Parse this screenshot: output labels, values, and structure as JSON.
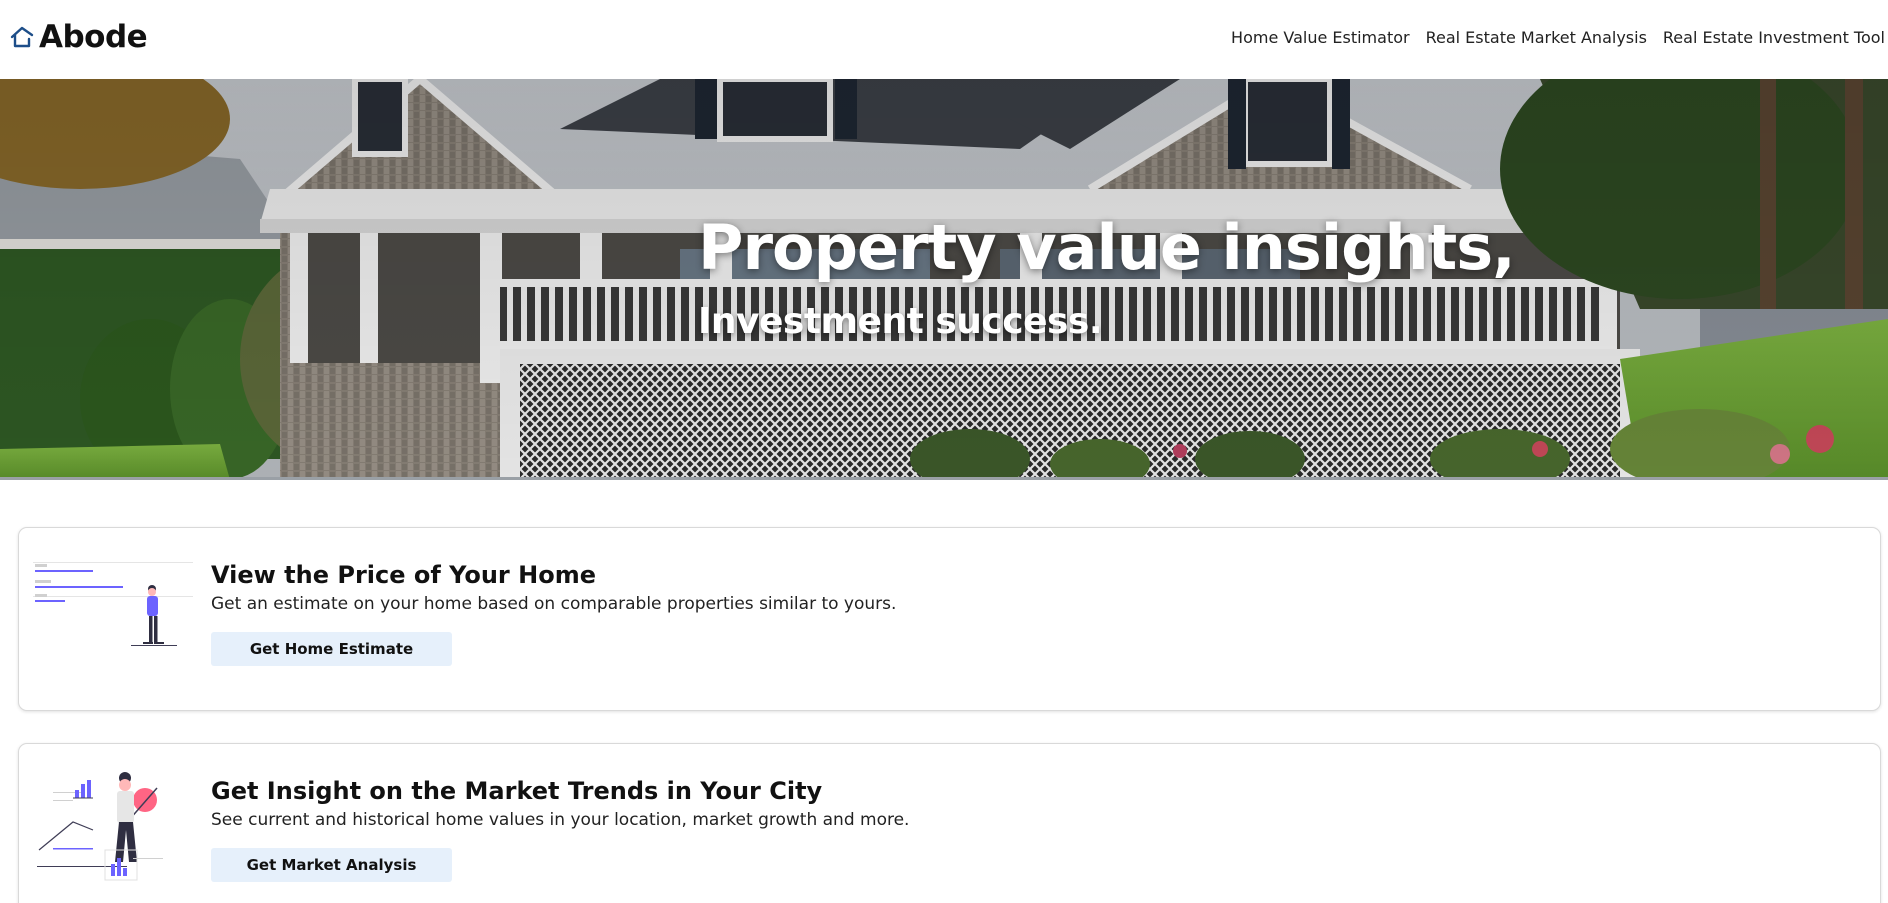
{
  "brand": {
    "name": "Abode",
    "icon": "house-icon",
    "accent": "#1d4e89"
  },
  "nav": {
    "items": [
      {
        "label": "Home Value Estimator"
      },
      {
        "label": "Real Estate Market Analysis"
      },
      {
        "label": "Real Estate Investment Tool"
      }
    ]
  },
  "hero": {
    "title": "Property value insights,",
    "subtitle": "Investment success.",
    "image": "house-porch-photo"
  },
  "cards": [
    {
      "title": "View the Price of Your Home",
      "description": "Get an estimate on your home based on comparable properties similar to yours.",
      "button_label": "Get Home Estimate",
      "illustration": "person-with-listing-illustration"
    },
    {
      "title": "Get Insight on the Market Trends in Your City",
      "description": "See current and historical home values in your location, market growth and more.",
      "button_label": "Get Market Analysis",
      "illustration": "person-with-charts-illustration"
    }
  ],
  "colors": {
    "button_bg": "#e6f0fb",
    "illustration_accent": "#6c63ff",
    "illustration_pink": "#ff6584"
  }
}
